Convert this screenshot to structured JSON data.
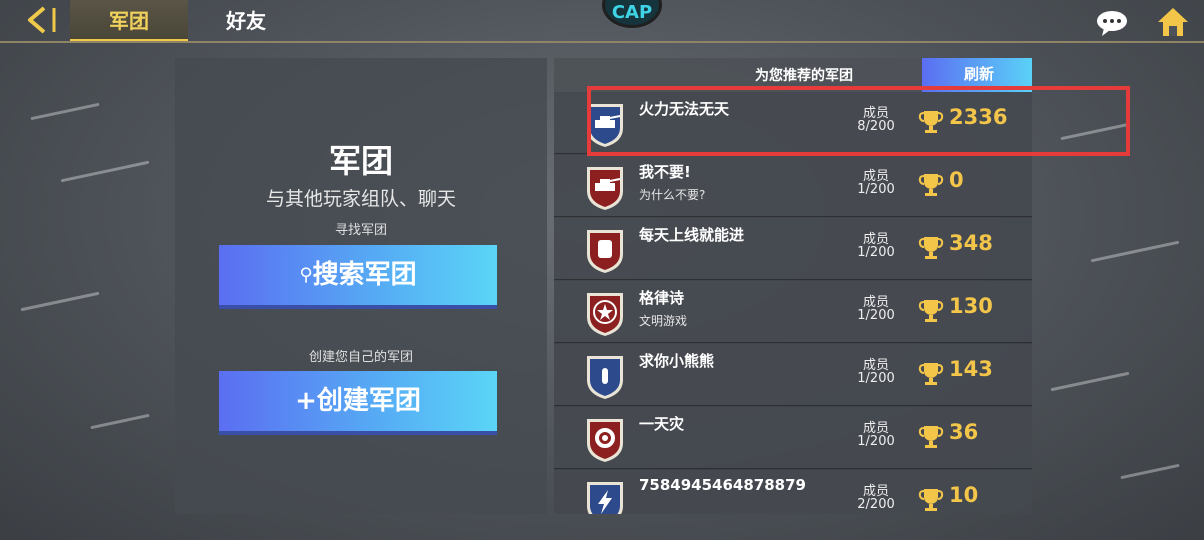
{
  "header": {
    "tabs": [
      {
        "label": "军团",
        "active": true
      },
      {
        "label": "好友",
        "active": false
      }
    ],
    "logo_text": "CAP"
  },
  "left_panel": {
    "title": "军团",
    "subtitle": "与其他玩家组队、聊天",
    "find_label": "寻找军团",
    "search_button": "搜索军团",
    "create_label": "创建您自己的军团",
    "create_button": "+创建军团"
  },
  "right_panel": {
    "title": "为您推荐的军团",
    "refresh_button": "刷新",
    "clans": [
      {
        "name": "火力无法无天",
        "desc": "",
        "members_label": "成员",
        "members": "8/200",
        "trophies": "2336",
        "badge": "tank-badge-icon",
        "badge_color": "#2c4a8c"
      },
      {
        "name": "我不要!",
        "desc": "为什么不要?",
        "members_label": "成员",
        "members": "1/200",
        "trophies": "0",
        "badge": "tank-badge-icon",
        "badge_color": "#8c1f1f"
      },
      {
        "name": "每天上线就能进",
        "desc": "",
        "members_label": "成员",
        "members": "1/200",
        "trophies": "348",
        "badge": "fist-badge-icon",
        "badge_color": "#8c1f1f"
      },
      {
        "name": "格律诗",
        "desc": "文明游戏",
        "members_label": "成员",
        "members": "1/200",
        "trophies": "130",
        "badge": "star-badge-icon",
        "badge_color": "#8c1f1f"
      },
      {
        "name": "求你小熊熊",
        "desc": "",
        "members_label": "成员",
        "members": "1/200",
        "trophies": "143",
        "badge": "bullet-badge-icon",
        "badge_color": "#2c4a8c"
      },
      {
        "name": "一天灾",
        "desc": "",
        "members_label": "成员",
        "members": "1/200",
        "trophies": "36",
        "badge": "gear-badge-icon",
        "badge_color": "#8c1f1f"
      },
      {
        "name": "7584945464878879",
        "desc": "",
        "members_label": "成员",
        "members": "2/200",
        "trophies": "10",
        "badge": "lightning-badge-icon",
        "badge_color": "#2c4a8c"
      }
    ]
  },
  "colors": {
    "accent_gold": "#f1c94a",
    "button_blue": "#5b6ef2",
    "button_cyan": "#5ad5f7",
    "highlight_red": "#e53b3b"
  }
}
